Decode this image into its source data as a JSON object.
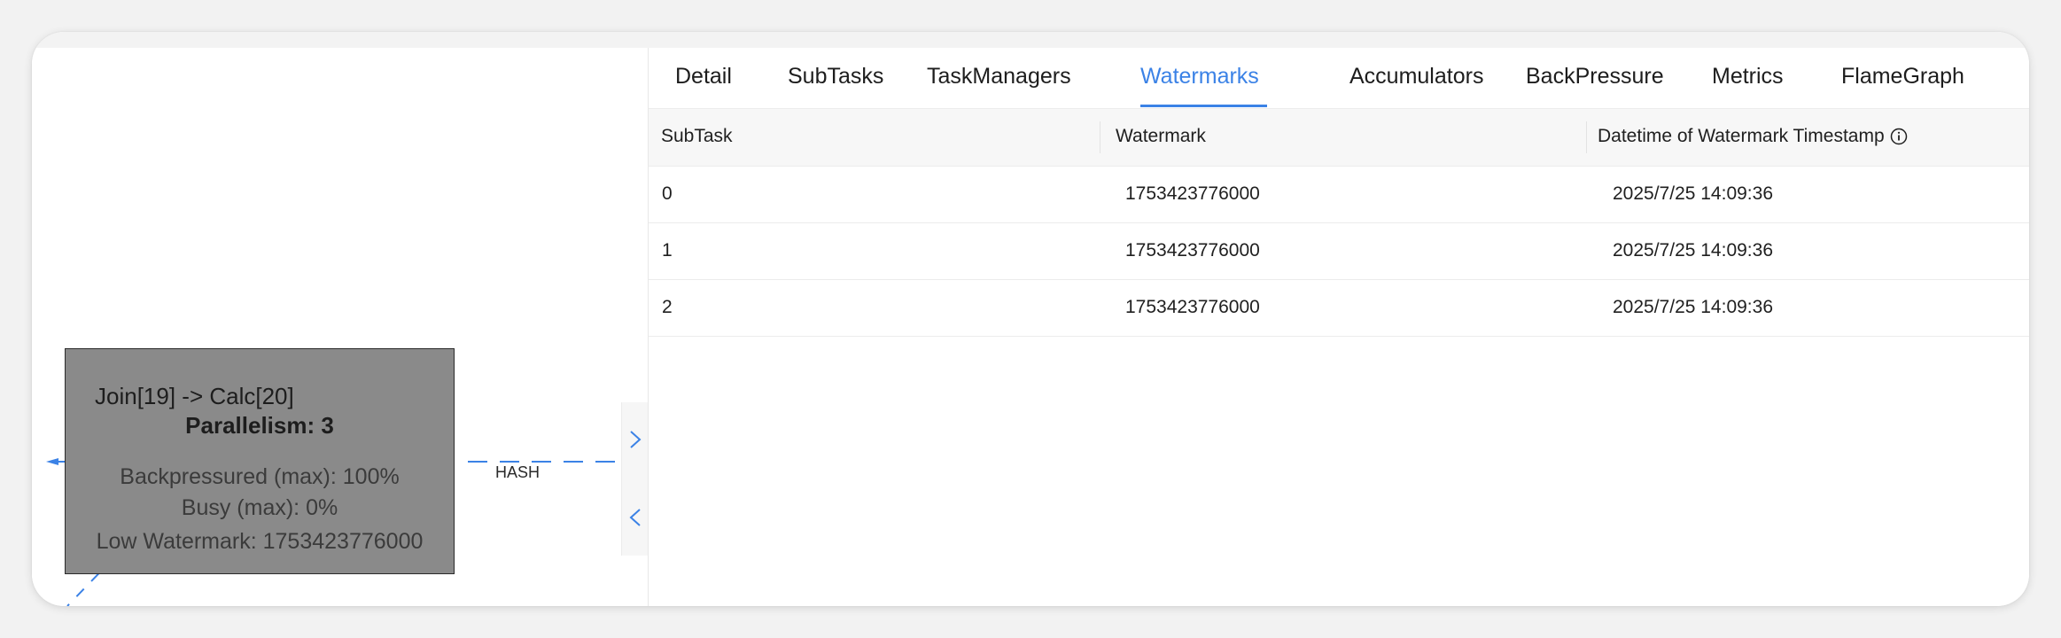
{
  "tabs": [
    {
      "label": "Detail",
      "active": false
    },
    {
      "label": "SubTasks",
      "active": false
    },
    {
      "label": "TaskManagers",
      "active": false
    },
    {
      "label": "Watermarks",
      "active": true
    },
    {
      "label": "Accumulators",
      "active": false
    },
    {
      "label": "BackPressure",
      "active": false
    },
    {
      "label": "Metrics",
      "active": false
    },
    {
      "label": "FlameGraph",
      "active": false
    }
  ],
  "table": {
    "headers": [
      "SubTask",
      "Watermark",
      "Datetime of Watermark Timestamp"
    ],
    "rows": [
      [
        "0",
        "1753423776000",
        "2025/7/25 14:09:36"
      ],
      [
        "1",
        "1753423776000",
        "2025/7/25 14:09:36"
      ],
      [
        "2",
        "1753423776000",
        "2025/7/25 14:09:36"
      ]
    ]
  },
  "graph": {
    "node": {
      "name": "Join[19] -> Calc[20]",
      "parallelism": "Parallelism: 3",
      "backpressured": "Backpressured (max): 100%",
      "busy": "Busy (max): 0%",
      "low_watermark": "Low Watermark: 1753423776000"
    },
    "edge_label": "HASH"
  },
  "icons": {
    "expand": "chevron-right-icon",
    "collapse": "chevron-left-icon",
    "info": "info-circle-icon"
  },
  "colors": {
    "accent": "#3b82e6",
    "node_fill": "#8a8a8a",
    "edge": "#3b82e6"
  }
}
